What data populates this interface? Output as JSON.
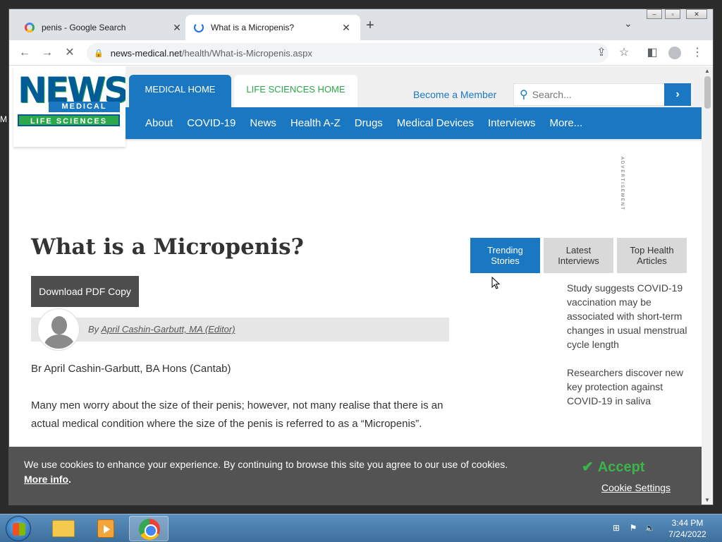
{
  "browser": {
    "tabs": [
      {
        "title": "penis - Google Search",
        "icon": "google-g-icon"
      },
      {
        "title": "What is a Micropenis?",
        "icon": "loading-spinner-icon"
      }
    ],
    "new_tab": "+",
    "url_domain": "news-medical.net",
    "url_path": "/health/What-is-Micropenis.aspx"
  },
  "site": {
    "logo": {
      "line1": "NEWS",
      "line2": "MEDICAL",
      "line3": "LIFE SCIENCES"
    },
    "medical_home": "MEDICAL HOME",
    "life_sciences_home": "LIFE SCIENCES HOME",
    "become_member": "Become a Member",
    "search_placeholder": "Search...",
    "nav": [
      "About",
      "COVID-19",
      "News",
      "Health A-Z",
      "Drugs",
      "Medical Devices",
      "Interviews",
      "More..."
    ],
    "advertisement_label": "ADVERTISEMENT",
    "accent_blue": "#1a78c2",
    "accent_green": "#2ba84a"
  },
  "article": {
    "title": "What is a Micropenis?",
    "download_pdf": "Download PDF Copy",
    "byline_prefix": "By",
    "author": "April Cashin-Garbutt, MA (Editor)",
    "p1": "Br April Cashin-Garbutt, BA Hons (Cantab)",
    "p2": "Many men worry about the size of their penis; however, not many realise that there is an actual medical condition where the size of the penis is referred to as a “Micropenis”."
  },
  "sidebar": {
    "tabs": [
      "Trending Stories",
      "Latest Interviews",
      "Top Health Articles"
    ],
    "stories": [
      "Study suggests COVID-19 vaccination may be associated with short-term changes in usual menstrual cycle length",
      "Researchers discover new key protection against COVID-19 in saliva"
    ]
  },
  "cookie": {
    "text": "We use cookies to enhance your experience. By continuing to browse this site you agree to our use of cookies.",
    "more_info": "More info",
    "more_info_suffix": ".",
    "accept": "Accept",
    "settings": "Cookie Settings"
  },
  "taskbar": {
    "time": "3:44 PM",
    "date": "7/24/2022"
  },
  "edge_letter": "M"
}
